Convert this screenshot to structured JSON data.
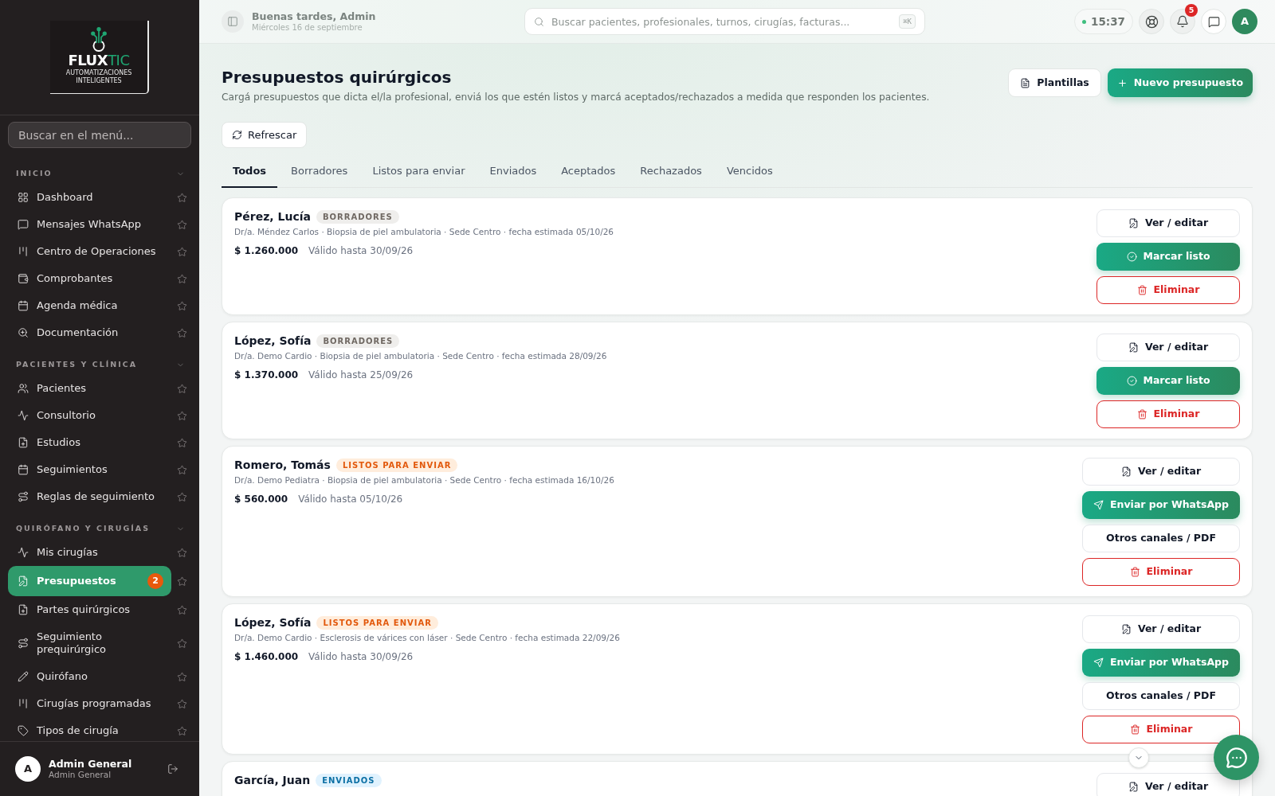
{
  "sidebar": {
    "logo": {
      "text": "FLUX",
      "accent": "TIC",
      "tagline": "AUTOMATIZACIONES INTELIGENTES"
    },
    "search": {
      "placeholder": "Buscar en el menú..."
    },
    "sections": [
      {
        "title": "INICIO",
        "expanded": true,
        "items": [
          {
            "label": "Dashboard",
            "selected": false
          },
          {
            "label": "Mensajes WhatsApp",
            "selected": false
          },
          {
            "label": "Centro de Operaciones",
            "selected": false
          },
          {
            "label": "Comprobantes",
            "selected": false
          },
          {
            "label": "Agenda médica",
            "selected": false
          },
          {
            "label": "Documentación",
            "selected": false
          }
        ]
      },
      {
        "title": "PACIENTES Y CLÍNICA",
        "expanded": true,
        "items": [
          {
            "label": "Pacientes",
            "selected": false
          },
          {
            "label": "Consultorio",
            "selected": false
          },
          {
            "label": "Estudios",
            "selected": false
          },
          {
            "label": "Seguimientos",
            "selected": false
          },
          {
            "label": "Reglas de seguimiento",
            "selected": false
          }
        ]
      },
      {
        "title": "QUIRÓFANO Y CIRUGÍAS",
        "expanded": true,
        "items": [
          {
            "label": "Mis cirugías",
            "selected": false
          },
          {
            "label": "Presupuestos",
            "selected": true,
            "badge": "2"
          },
          {
            "label": "Partes quirúrgicos",
            "selected": false
          },
          {
            "label": "Seguimiento prequirúrgico",
            "selected": false
          },
          {
            "label": "Quirófano",
            "selected": false
          },
          {
            "label": "Cirugías programadas",
            "selected": false
          },
          {
            "label": "Tipos de cirugía",
            "selected": false
          }
        ]
      }
    ],
    "user": {
      "initial": "A",
      "name": "Admin General",
      "role": "Admin General"
    }
  },
  "header": {
    "greeting": "Buenas tardes, Admin",
    "date": "Miércoles 16 de septiembre",
    "search": {
      "placeholder": "Buscar pacientes, profesionales, turnos, cirugías, facturas...",
      "shortcut": "⌘K"
    },
    "clock": "15:37",
    "notifications": "5",
    "avatar": "A"
  },
  "page": {
    "title": "Presupuestos quirúrgicos",
    "subtitle": "Cargá presupuestos que dicta el/la profesional, enviá los que estén listos y marcá aceptados/rechazados a medida que responden los pacientes.",
    "buttons": [
      {
        "label": "Plantillas",
        "kind": "secondary"
      },
      {
        "label": "Nuevo presupuesto",
        "kind": "primary"
      }
    ],
    "refresh": "Refrescar"
  },
  "tabs": [
    {
      "label": "Todos",
      "selected": true
    },
    {
      "label": "Borradores",
      "selected": false
    },
    {
      "label": "Listos para enviar",
      "selected": false
    },
    {
      "label": "Enviados",
      "selected": false
    },
    {
      "label": "Aceptados",
      "selected": false
    },
    {
      "label": "Rechazados",
      "selected": false
    },
    {
      "label": "Vencidos",
      "selected": false
    }
  ],
  "budgets": [
    {
      "patient": "Pérez, Lucía",
      "status": {
        "label": "BORRADORES",
        "kind": "draft"
      },
      "meta": "Dr/a. Méndez Carlos · Biopsia de piel ambulatoria · Sede Centro · fecha estimada 05/10/26",
      "amount": "$ 1.260.000",
      "valid": "Válido hasta 30/09/26",
      "actions": [
        {
          "label": "Ver / editar",
          "kind": "edit"
        },
        {
          "label": "Marcar listo",
          "kind": "ready"
        },
        {
          "label": "Eliminar",
          "kind": "delete"
        }
      ]
    },
    {
      "patient": "López, Sofía",
      "status": {
        "label": "BORRADORES",
        "kind": "draft"
      },
      "meta": "Dr/a. Demo Cardio · Biopsia de piel ambulatoria · Sede Centro · fecha estimada 28/09/26",
      "amount": "$ 1.370.000",
      "valid": "Válido hasta 25/09/26",
      "actions": [
        {
          "label": "Ver / editar",
          "kind": "edit"
        },
        {
          "label": "Marcar listo",
          "kind": "ready"
        },
        {
          "label": "Eliminar",
          "kind": "delete"
        }
      ]
    },
    {
      "patient": "Romero, Tomás",
      "status": {
        "label": "LISTOS PARA ENVIAR",
        "kind": "ready"
      },
      "meta": "Dr/a. Demo Pediatra · Biopsia de piel ambulatoria · Sede Centro · fecha estimada 16/10/26",
      "amount": "$ 560.000",
      "valid": "Válido hasta 05/10/26",
      "actions": [
        {
          "label": "Ver / editar",
          "kind": "edit"
        },
        {
          "label": "Enviar por WhatsApp",
          "kind": "whatsapp"
        },
        {
          "label": "Otros canales / PDF",
          "kind": "other"
        },
        {
          "label": "Eliminar",
          "kind": "delete"
        }
      ]
    },
    {
      "patient": "López, Sofía",
      "status": {
        "label": "LISTOS PARA ENVIAR",
        "kind": "ready"
      },
      "meta": "Dr/a. Demo Cardio · Esclerosis de várices con láser · Sede Centro · fecha estimada 22/09/26",
      "amount": "$ 1.460.000",
      "valid": "Válido hasta 30/09/26",
      "actions": [
        {
          "label": "Ver / editar",
          "kind": "edit"
        },
        {
          "label": "Enviar por WhatsApp",
          "kind": "whatsapp"
        },
        {
          "label": "Otros canales / PDF",
          "kind": "other"
        },
        {
          "label": "Eliminar",
          "kind": "delete"
        }
      ]
    },
    {
      "patient": "García, Juan",
      "status": {
        "label": "ENVIADOS",
        "kind": "sent"
      },
      "actions": [
        {
          "label": "Ver / editar",
          "kind": "edit"
        }
      ]
    }
  ]
}
